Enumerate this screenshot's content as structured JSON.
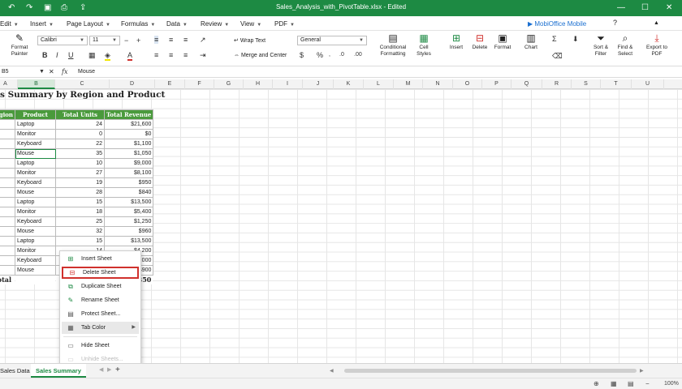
{
  "titlebar": {
    "filename": "Sales_Analysis_with_PivotTable.xlsx - Edited"
  },
  "menu": [
    {
      "label": "Edit"
    },
    {
      "label": "Insert"
    },
    {
      "label": "Page Layout"
    },
    {
      "label": "Formulas"
    },
    {
      "label": "Data"
    },
    {
      "label": "Review"
    },
    {
      "label": "View"
    },
    {
      "label": "PDF"
    }
  ],
  "mobioffice": {
    "label": "MobiOffice Mobile"
  },
  "ribbon": {
    "format_painter": "Format Painter",
    "font_name": "Calibri",
    "font_size": "11",
    "wrap_text": "Wrap Text",
    "merge_center": "Merge and Center",
    "number_format": "General",
    "currency_symbol": "$",
    "percent_symbol": "%",
    "conditional_formatting": "Conditional Formatting",
    "cell_styles": "Cell Styles",
    "insert": "Insert",
    "delete": "Delete",
    "format": "Format",
    "chart": "Chart",
    "sort_filter": "Sort & Filter",
    "find_select": "Find & Select",
    "export_pdf": "Export to PDF"
  },
  "formula_bar": {
    "cell_ref": "B5",
    "fx": "fx",
    "value": "Mouse"
  },
  "columns": [
    "A",
    "B",
    "C",
    "D",
    "E",
    "F",
    "G",
    "H",
    "I",
    "J",
    "K",
    "L",
    "M",
    "N",
    "O",
    "P",
    "Q",
    "R",
    "S",
    "T",
    "U"
  ],
  "sheet": {
    "title": "s Summary by Region and Product",
    "headers": [
      "gion",
      "Product",
      "Total Units",
      "Total Revenue"
    ],
    "rows": [
      {
        "product": "Laptop",
        "units": "24",
        "revenue": "$21,600"
      },
      {
        "product": "Monitor",
        "units": "0",
        "revenue": "$0"
      },
      {
        "product": "Keyboard",
        "units": "22",
        "revenue": "$1,100"
      },
      {
        "product": "Mouse",
        "units": "35",
        "revenue": "$1,050"
      },
      {
        "product": "Laptop",
        "units": "10",
        "revenue": "$9,000"
      },
      {
        "product": "Monitor",
        "units": "27",
        "revenue": "$8,100"
      },
      {
        "product": "Keyboard",
        "units": "19",
        "revenue": "$950"
      },
      {
        "product": "Mouse",
        "units": "28",
        "revenue": "$840"
      },
      {
        "product": "Laptop",
        "units": "15",
        "revenue": "$13,500"
      },
      {
        "product": "Monitor",
        "units": "18",
        "revenue": "$5,400"
      },
      {
        "product": "Keyboard",
        "units": "25",
        "revenue": "$1,250"
      },
      {
        "product": "Mouse",
        "units": "32",
        "revenue": "$960"
      },
      {
        "product": "Laptop",
        "units": "15",
        "revenue": "$13,500"
      },
      {
        "product": "Monitor",
        "units": "14",
        "revenue": "$4,200"
      },
      {
        "product": "Keyboard",
        "units": "",
        "revenue": "$1,000"
      },
      {
        "product": "Mouse",
        "units": "",
        "revenue": "$900"
      }
    ],
    "total_label": "d Total",
    "total_revenue": ",350"
  },
  "context_menu": {
    "items": [
      {
        "label": "Insert Sheet"
      },
      {
        "label": "Delete Sheet"
      },
      {
        "label": "Duplicate Sheet"
      },
      {
        "label": "Rename Sheet"
      },
      {
        "label": "Protect Sheet..."
      },
      {
        "label": "Tab Color"
      },
      {
        "label": "Hide Sheet"
      },
      {
        "label": "Unhide Sheets..."
      }
    ],
    "highlight_color": "#d0312d"
  },
  "tabs": [
    {
      "label": "Sales Data"
    },
    {
      "label": "Sales Summary"
    }
  ],
  "status": {
    "zoom": "100%"
  },
  "colors": {
    "accent": "#1d8a43",
    "header_fill": "#4a9a3c"
  }
}
